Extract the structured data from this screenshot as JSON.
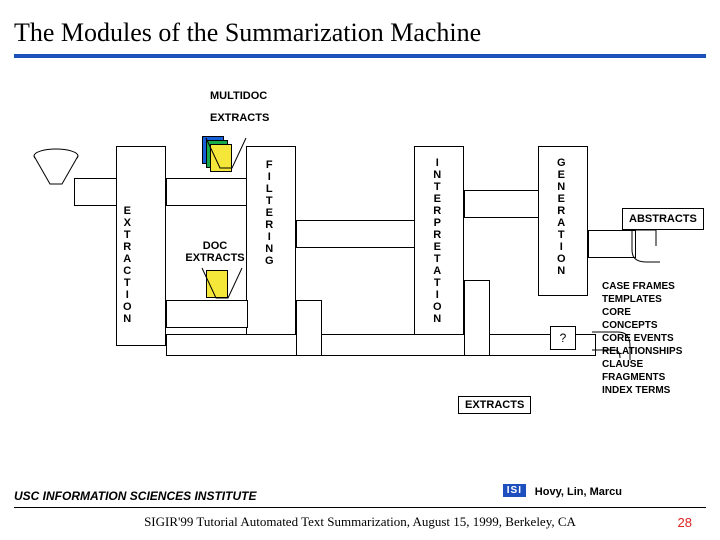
{
  "title": "The Modules of the Summarization Machine",
  "labels": {
    "multidoc": "MULTIDOC",
    "extracts_top": "EXTRACTS",
    "doc_extracts_l1": "DOC",
    "doc_extracts_l2": "EXTRACTS",
    "extracts_bottom": "EXTRACTS",
    "abstracts": "ABSTRACTS",
    "question": "?"
  },
  "modules": {
    "extraction": "EXTRACTION",
    "filtering": "FILTERING",
    "interpretation": "INTERPRETATION",
    "generation": "GENERATION"
  },
  "outputs": [
    "CASE FRAMES",
    "TEMPLATES",
    "CORE CONCEPTS",
    "CORE EVENTS",
    "RELATIONSHIPS",
    "CLAUSE FRAGMENTS",
    "INDEX TERMS"
  ],
  "footer": {
    "institute": "USC INFORMATION SCIENCES INSTITUTE",
    "isi_badge": "ISI",
    "authors": "Hovy, Lin, Marcu",
    "conference": "SIGIR'99 Tutorial Automated Text Summarization, August 15, 1999, Berkeley, CA",
    "page": "28"
  }
}
